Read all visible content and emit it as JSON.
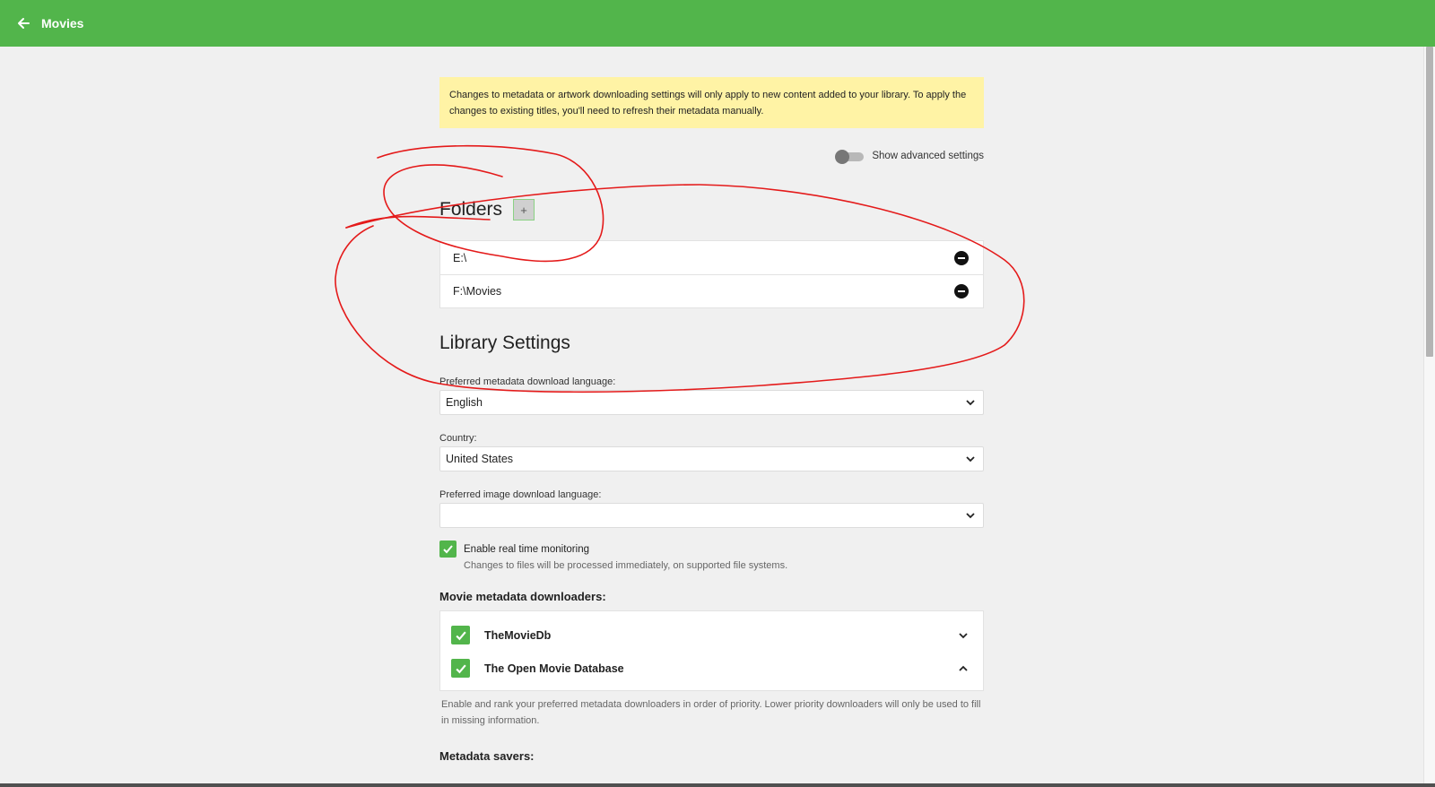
{
  "appbar": {
    "title": "Movies",
    "back_icon": "arrow-left-icon",
    "color": "#52b54b"
  },
  "notice": {
    "text": "Changes to metadata or artwork downloading settings will only apply to new content added to your library. To apply the changes to existing titles, you'll need to refresh their metadata manually."
  },
  "advanced": {
    "label": "Show advanced settings",
    "enabled": false
  },
  "folders": {
    "title": "Folders",
    "add_symbol": "+",
    "items": [
      {
        "path": "E:\\"
      },
      {
        "path": "F:\\Movies"
      }
    ]
  },
  "library": {
    "title": "Library Settings",
    "metadata_language": {
      "label": "Preferred metadata download language:",
      "value": "English"
    },
    "country": {
      "label": "Country:",
      "value": "United States"
    },
    "image_language": {
      "label": "Preferred image download language:",
      "value": ""
    },
    "realtime": {
      "label": "Enable real time monitoring",
      "description": "Changes to files will be processed immediately, on supported file systems.",
      "checked": true
    },
    "downloaders": {
      "title": "Movie metadata downloaders:",
      "items": [
        {
          "name": "TheMovieDb",
          "checked": true,
          "chevron": "chevron-down-icon"
        },
        {
          "name": "The Open Movie Database",
          "checked": true,
          "chevron": "chevron-up-icon"
        }
      ],
      "description": "Enable and rank your preferred metadata downloaders in order of priority. Lower priority downloaders will only be used to fill in missing information."
    },
    "savers": {
      "title": "Metadata savers:"
    }
  },
  "annotation_color": "#e41a1a"
}
